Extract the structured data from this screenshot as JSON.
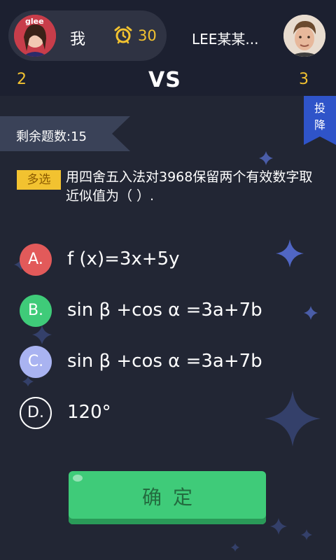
{
  "header": {
    "player_name": "我",
    "timer_value": "30",
    "opponent_name": "LEE某某...",
    "player_score": "2",
    "opponent_score": "3",
    "vs_label": "VS",
    "surrender_label_line1": "投",
    "surrender_label_line2": "降",
    "avatar_logo_text": "glee"
  },
  "question": {
    "remaining_label": "剩余题数:15",
    "type_badge": "多选",
    "text": "用四舍五入法对3968保留两个有效数字取近似值为（ ）."
  },
  "options": [
    {
      "letter": "A.",
      "text": "f (x)=3x+5y",
      "color": "#e25a5a",
      "style": "filled"
    },
    {
      "letter": "B.",
      "text": "sin β +cos α =3a+7b",
      "color": "#3fcb79",
      "style": "filled"
    },
    {
      "letter": "C.",
      "text": "sin β +cos α =3a+7b",
      "color": "#a9b3f1",
      "style": "filled"
    },
    {
      "letter": "D.",
      "text": "120°",
      "color": "#ffffff",
      "style": "outline"
    }
  ],
  "confirm_button": {
    "label": "确定"
  },
  "colors": {
    "background": "#222634",
    "accent_yellow": "#f2c230",
    "confirm_green": "#3fcb79",
    "surrender_blue": "#2f54c9",
    "star_blue": "#4a5da8"
  },
  "icons": {
    "timer": "alarm-clock-icon",
    "surrender": "flag-icon",
    "decor": "sparkle-star-icon"
  }
}
